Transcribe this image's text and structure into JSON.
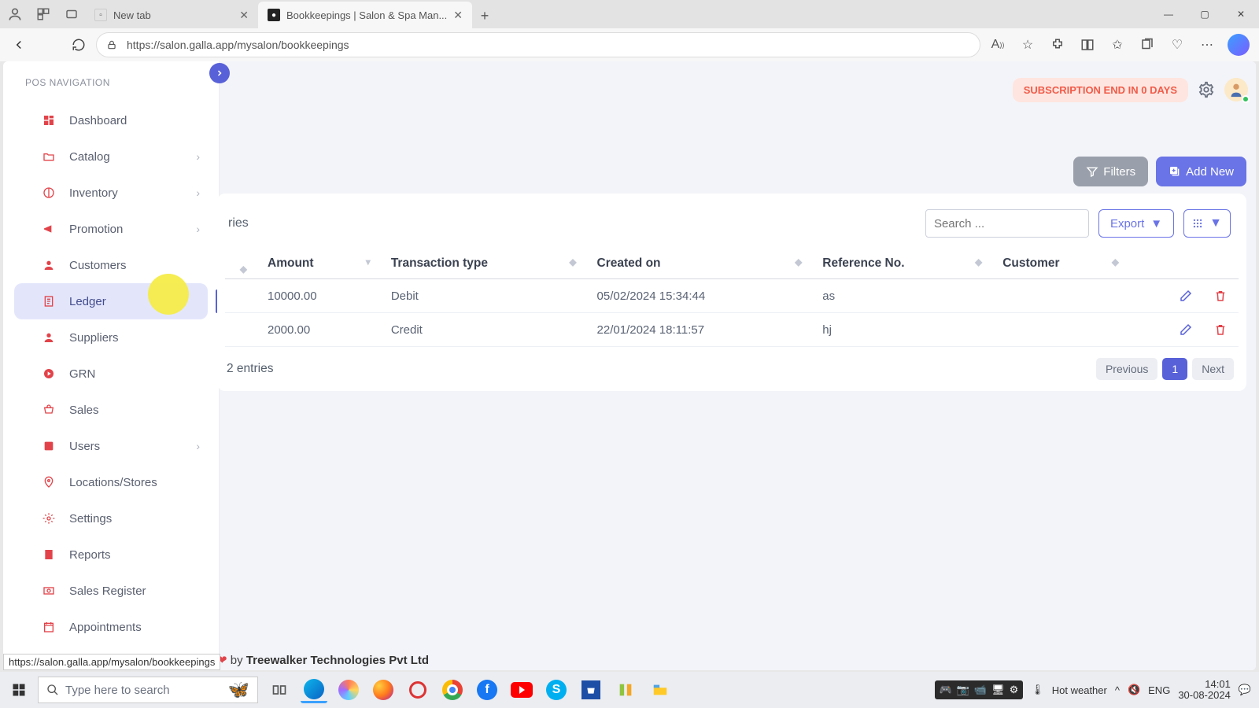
{
  "browser": {
    "tabs": [
      {
        "title": "New tab"
      },
      {
        "title": "Bookkeepings | Salon & Spa Man..."
      }
    ],
    "url": "https://salon.galla.app/mysalon/bookkeepings"
  },
  "sidebar": {
    "heading": "POS NAVIGATION",
    "items": [
      {
        "label": "Dashboard"
      },
      {
        "label": "Catalog"
      },
      {
        "label": "Inventory"
      },
      {
        "label": "Promotion"
      },
      {
        "label": "Customers"
      },
      {
        "label": "Ledger"
      },
      {
        "label": "Suppliers"
      },
      {
        "label": "GRN"
      },
      {
        "label": "Sales"
      },
      {
        "label": "Users"
      },
      {
        "label": "Locations/Stores"
      },
      {
        "label": "Settings"
      },
      {
        "label": "Reports"
      },
      {
        "label": "Sales Register"
      },
      {
        "label": "Appointments"
      }
    ]
  },
  "header": {
    "subscription": "SUBSCRIPTION END IN 0 DAYS"
  },
  "toolbar": {
    "filters": "Filters",
    "add": "Add New"
  },
  "table": {
    "entries_suffix": "ries",
    "search_placeholder": "Search ...",
    "export": "Export",
    "columns": [
      "Amount",
      "Transaction type",
      "Created on",
      "Reference No.",
      "Customer"
    ],
    "rows": [
      {
        "amount": "10000.00",
        "type": "Debit",
        "created": "05/02/2024 15:34:44",
        "ref": "as",
        "customer": ""
      },
      {
        "amount": "2000.00",
        "type": "Credit",
        "created": "22/01/2024 18:11:57",
        "ref": "hj",
        "customer": ""
      }
    ],
    "showing": "2 entries",
    "pager": {
      "prev": "Previous",
      "page": "1",
      "next": "Next"
    }
  },
  "footer": {
    "by": "by ",
    "company": "Treewalker Technologies Pvt Ltd"
  },
  "status_url": "https://salon.galla.app/mysalon/bookkeepings",
  "taskbar": {
    "search_placeholder": "Type here to search",
    "weather": "Hot weather",
    "lang": "ENG",
    "time": "14:01",
    "date": "30-08-2024"
  }
}
